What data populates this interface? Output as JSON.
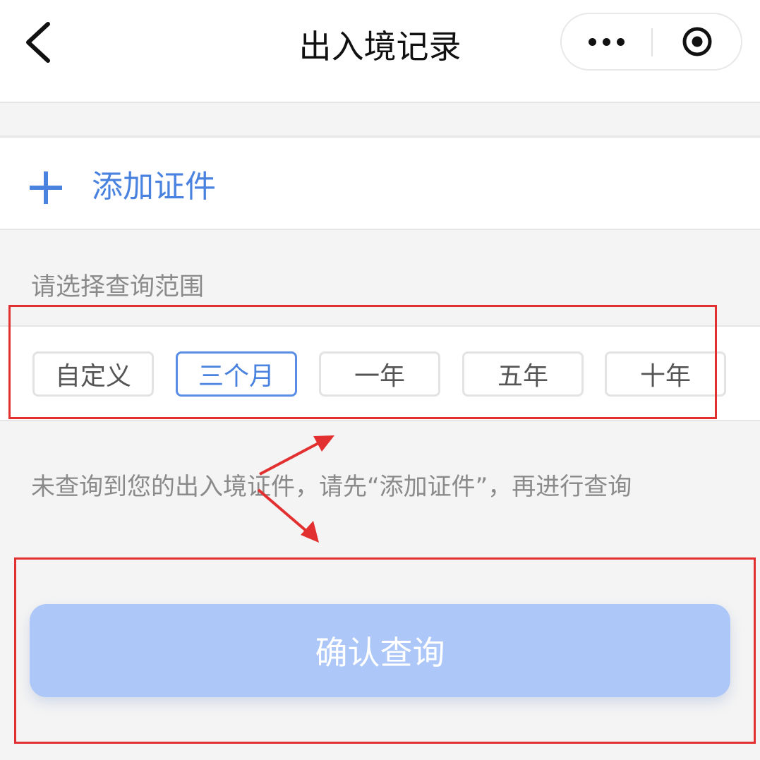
{
  "navbar": {
    "title": "出入境记录",
    "back_icon": "chevron-left-icon",
    "more_icon": "more-dots-icon",
    "close_icon": "target-circle-icon"
  },
  "add_document": {
    "label": "添加证件",
    "icon": "plus-icon",
    "color": "#4a82e0"
  },
  "range": {
    "label": "请选择查询范围",
    "options": [
      "自定义",
      "三个月",
      "一年",
      "五年",
      "十年"
    ],
    "selected": "三个月"
  },
  "hint": "未查询到您的出入境证件，请先“添加证件”，再进行查询",
  "confirm": {
    "label": "确认查询",
    "color": "#adc8f8"
  },
  "annotation_color": "#e23030"
}
